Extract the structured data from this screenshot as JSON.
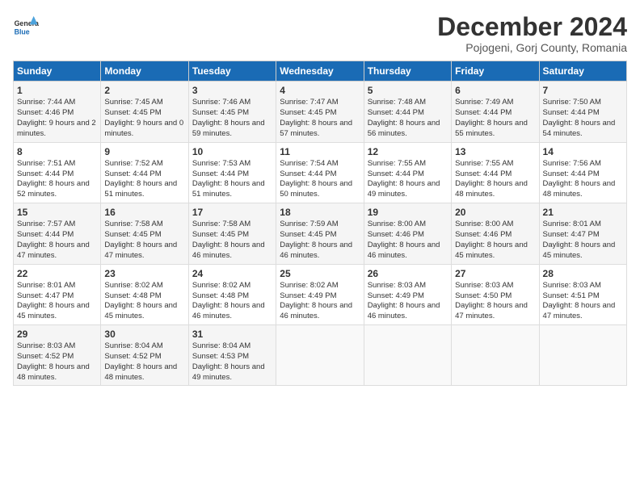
{
  "logo": {
    "general": "General",
    "blue": "Blue"
  },
  "title": "December 2024",
  "subtitle": "Pojogeni, Gorj County, Romania",
  "headers": [
    "Sunday",
    "Monday",
    "Tuesday",
    "Wednesday",
    "Thursday",
    "Friday",
    "Saturday"
  ],
  "weeks": [
    [
      {
        "day": "1",
        "sunrise": "Sunrise: 7:44 AM",
        "sunset": "Sunset: 4:46 PM",
        "daylight": "Daylight: 9 hours and 2 minutes."
      },
      {
        "day": "2",
        "sunrise": "Sunrise: 7:45 AM",
        "sunset": "Sunset: 4:45 PM",
        "daylight": "Daylight: 9 hours and 0 minutes."
      },
      {
        "day": "3",
        "sunrise": "Sunrise: 7:46 AM",
        "sunset": "Sunset: 4:45 PM",
        "daylight": "Daylight: 8 hours and 59 minutes."
      },
      {
        "day": "4",
        "sunrise": "Sunrise: 7:47 AM",
        "sunset": "Sunset: 4:45 PM",
        "daylight": "Daylight: 8 hours and 57 minutes."
      },
      {
        "day": "5",
        "sunrise": "Sunrise: 7:48 AM",
        "sunset": "Sunset: 4:44 PM",
        "daylight": "Daylight: 8 hours and 56 minutes."
      },
      {
        "day": "6",
        "sunrise": "Sunrise: 7:49 AM",
        "sunset": "Sunset: 4:44 PM",
        "daylight": "Daylight: 8 hours and 55 minutes."
      },
      {
        "day": "7",
        "sunrise": "Sunrise: 7:50 AM",
        "sunset": "Sunset: 4:44 PM",
        "daylight": "Daylight: 8 hours and 54 minutes."
      }
    ],
    [
      {
        "day": "8",
        "sunrise": "Sunrise: 7:51 AM",
        "sunset": "Sunset: 4:44 PM",
        "daylight": "Daylight: 8 hours and 52 minutes."
      },
      {
        "day": "9",
        "sunrise": "Sunrise: 7:52 AM",
        "sunset": "Sunset: 4:44 PM",
        "daylight": "Daylight: 8 hours and 51 minutes."
      },
      {
        "day": "10",
        "sunrise": "Sunrise: 7:53 AM",
        "sunset": "Sunset: 4:44 PM",
        "daylight": "Daylight: 8 hours and 51 minutes."
      },
      {
        "day": "11",
        "sunrise": "Sunrise: 7:54 AM",
        "sunset": "Sunset: 4:44 PM",
        "daylight": "Daylight: 8 hours and 50 minutes."
      },
      {
        "day": "12",
        "sunrise": "Sunrise: 7:55 AM",
        "sunset": "Sunset: 4:44 PM",
        "daylight": "Daylight: 8 hours and 49 minutes."
      },
      {
        "day": "13",
        "sunrise": "Sunrise: 7:55 AM",
        "sunset": "Sunset: 4:44 PM",
        "daylight": "Daylight: 8 hours and 48 minutes."
      },
      {
        "day": "14",
        "sunrise": "Sunrise: 7:56 AM",
        "sunset": "Sunset: 4:44 PM",
        "daylight": "Daylight: 8 hours and 48 minutes."
      }
    ],
    [
      {
        "day": "15",
        "sunrise": "Sunrise: 7:57 AM",
        "sunset": "Sunset: 4:44 PM",
        "daylight": "Daylight: 8 hours and 47 minutes."
      },
      {
        "day": "16",
        "sunrise": "Sunrise: 7:58 AM",
        "sunset": "Sunset: 4:45 PM",
        "daylight": "Daylight: 8 hours and 47 minutes."
      },
      {
        "day": "17",
        "sunrise": "Sunrise: 7:58 AM",
        "sunset": "Sunset: 4:45 PM",
        "daylight": "Daylight: 8 hours and 46 minutes."
      },
      {
        "day": "18",
        "sunrise": "Sunrise: 7:59 AM",
        "sunset": "Sunset: 4:45 PM",
        "daylight": "Daylight: 8 hours and 46 minutes."
      },
      {
        "day": "19",
        "sunrise": "Sunrise: 8:00 AM",
        "sunset": "Sunset: 4:46 PM",
        "daylight": "Daylight: 8 hours and 46 minutes."
      },
      {
        "day": "20",
        "sunrise": "Sunrise: 8:00 AM",
        "sunset": "Sunset: 4:46 PM",
        "daylight": "Daylight: 8 hours and 45 minutes."
      },
      {
        "day": "21",
        "sunrise": "Sunrise: 8:01 AM",
        "sunset": "Sunset: 4:47 PM",
        "daylight": "Daylight: 8 hours and 45 minutes."
      }
    ],
    [
      {
        "day": "22",
        "sunrise": "Sunrise: 8:01 AM",
        "sunset": "Sunset: 4:47 PM",
        "daylight": "Daylight: 8 hours and 45 minutes."
      },
      {
        "day": "23",
        "sunrise": "Sunrise: 8:02 AM",
        "sunset": "Sunset: 4:48 PM",
        "daylight": "Daylight: 8 hours and 45 minutes."
      },
      {
        "day": "24",
        "sunrise": "Sunrise: 8:02 AM",
        "sunset": "Sunset: 4:48 PM",
        "daylight": "Daylight: 8 hours and 46 minutes."
      },
      {
        "day": "25",
        "sunrise": "Sunrise: 8:02 AM",
        "sunset": "Sunset: 4:49 PM",
        "daylight": "Daylight: 8 hours and 46 minutes."
      },
      {
        "day": "26",
        "sunrise": "Sunrise: 8:03 AM",
        "sunset": "Sunset: 4:49 PM",
        "daylight": "Daylight: 8 hours and 46 minutes."
      },
      {
        "day": "27",
        "sunrise": "Sunrise: 8:03 AM",
        "sunset": "Sunset: 4:50 PM",
        "daylight": "Daylight: 8 hours and 47 minutes."
      },
      {
        "day": "28",
        "sunrise": "Sunrise: 8:03 AM",
        "sunset": "Sunset: 4:51 PM",
        "daylight": "Daylight: 8 hours and 47 minutes."
      }
    ],
    [
      {
        "day": "29",
        "sunrise": "Sunrise: 8:03 AM",
        "sunset": "Sunset: 4:52 PM",
        "daylight": "Daylight: 8 hours and 48 minutes."
      },
      {
        "day": "30",
        "sunrise": "Sunrise: 8:04 AM",
        "sunset": "Sunset: 4:52 PM",
        "daylight": "Daylight: 8 hours and 48 minutes."
      },
      {
        "day": "31",
        "sunrise": "Sunrise: 8:04 AM",
        "sunset": "Sunset: 4:53 PM",
        "daylight": "Daylight: 8 hours and 49 minutes."
      },
      null,
      null,
      null,
      null
    ]
  ]
}
